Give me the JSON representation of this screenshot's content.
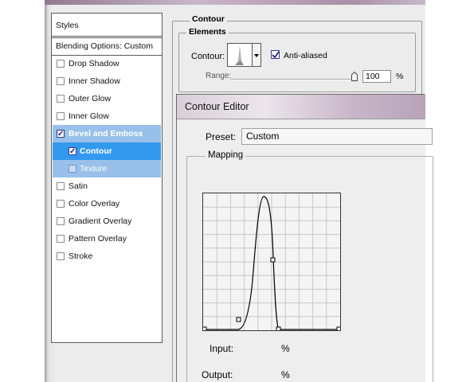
{
  "styles_panel": {
    "header": "Styles",
    "blending": "Blending Options: Custom",
    "items": [
      {
        "label": "Drop Shadow",
        "checked": false
      },
      {
        "label": "Inner Shadow",
        "checked": false
      },
      {
        "label": "Outer Glow",
        "checked": false
      },
      {
        "label": "Inner Glow",
        "checked": false
      },
      {
        "label": "Bevel and Emboss",
        "checked": true
      },
      {
        "label": "Contour",
        "checked": true
      },
      {
        "label": "Texture",
        "checked": false
      },
      {
        "label": "Satin",
        "checked": false
      },
      {
        "label": "Color Overlay",
        "checked": false
      },
      {
        "label": "Gradient Overlay",
        "checked": false
      },
      {
        "label": "Pattern Overlay",
        "checked": false
      },
      {
        "label": "Stroke",
        "checked": false
      }
    ]
  },
  "contour_section": {
    "title": "Contour",
    "elements_title": "Elements",
    "contour_label": "Contour:",
    "anti_aliased_label": "Anti-aliased",
    "anti_aliased": true,
    "range_label": "Range:",
    "range_value": "100",
    "range_unit": "%"
  },
  "editor": {
    "title": "Contour Editor",
    "preset_label": "Preset:",
    "preset_value": "Custom",
    "mapping_title": "Mapping",
    "input_label": "Input:",
    "input_unit": "%",
    "output_label": "Output:",
    "output_unit": "%"
  },
  "colors": {
    "selected_row": "#98c0ea",
    "active_row": "#3399ee"
  }
}
